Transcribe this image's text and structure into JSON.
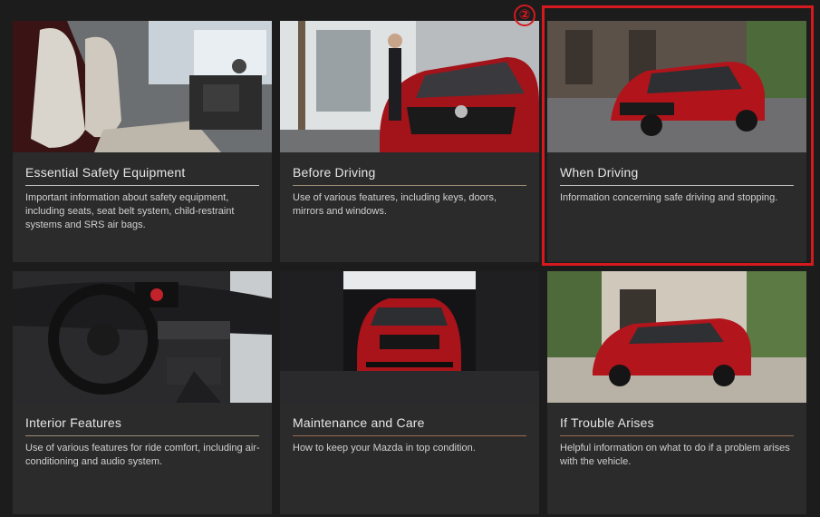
{
  "cards": [
    {
      "title": "Essential Safety Equipment",
      "description": "Important information about safety equipment, including seats, seat belt system, child-restraint systems and SRS air bags."
    },
    {
      "title": "Before Driving",
      "description": "Use of various features, including keys, doors, mirrors and windows."
    },
    {
      "title": "When Driving",
      "description": "Information concerning safe driving and stopping."
    },
    {
      "title": "Interior Features",
      "description": "Use of various features for ride comfort, including air-conditioning and audio system."
    },
    {
      "title": "Maintenance and Care",
      "description": "How to keep your Mazda in top condition."
    },
    {
      "title": "If Trouble Arises",
      "description": "Helpful information on what to do if a problem arises with the vehicle."
    }
  ],
  "annotation": {
    "marker_label": "②",
    "color": "#d4191f"
  },
  "colors": {
    "rule_gold": "#9a8c74",
    "rule_silver": "#bdbdbd",
    "rule_copper": "#9a6a4c"
  }
}
